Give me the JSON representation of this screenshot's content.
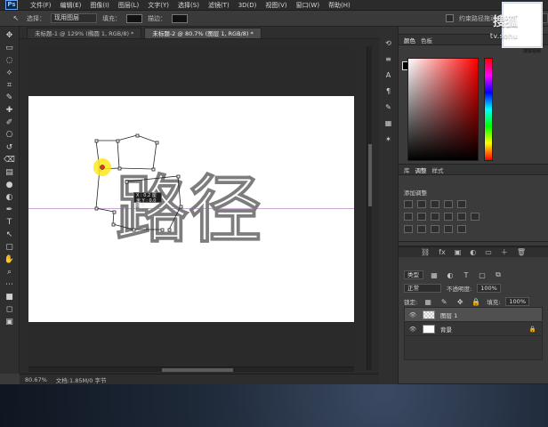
{
  "app": {
    "logo_text": "Ps",
    "menus": [
      "文件(F)",
      "编辑(E)",
      "图像(I)",
      "图层(L)",
      "文字(Y)",
      "选择(S)",
      "滤镜(T)",
      "3D(D)",
      "视图(V)",
      "窗口(W)",
      "帮助(H)"
    ]
  },
  "options": {
    "select_label": "选择：",
    "select_value": "现用图层",
    "fill_label": "填充：",
    "stroke_label": "描边：",
    "constrain_label": "约束路径拖动",
    "workspace": "基本功能"
  },
  "tabs": [
    {
      "label": "未标题-1 @ 129% (椭圆 1, RGB/8) *",
      "active": false
    },
    {
      "label": "未标题-2 @ 80.7% (图层 1, RGB/8) *",
      "active": true
    }
  ],
  "canvas": {
    "guide_color": "#c09ac9",
    "tooltip": "X : 0.2 厘米\nY : 0.0 厘米",
    "text": "路径"
  },
  "status": {
    "zoom": "80.67%",
    "doc": "文档:1.85M/0 字节"
  },
  "panels": {
    "color_tabs": [
      "颜色",
      "色板"
    ],
    "adjust_tabs": [
      "库",
      "调整",
      "样式"
    ],
    "adjust_title": "添加调整",
    "layers_tabs": [
      "图层",
      "通道",
      "路径"
    ],
    "kind_label": "类型",
    "blend_mode": "正常",
    "opacity_label": "不透明度:",
    "opacity_value": "100%",
    "lock_label": "锁定:",
    "fill_label": "填充:",
    "fill_value": "100%",
    "layers": [
      {
        "name": "图层 1",
        "active": true,
        "thumb": "checker",
        "locked": false
      },
      {
        "name": "背景",
        "active": false,
        "thumb": "white",
        "locked": true
      }
    ]
  },
  "watermark": {
    "brand": "搜狐",
    "sub": "tv.sohu",
    "small": "搜狐视频"
  }
}
